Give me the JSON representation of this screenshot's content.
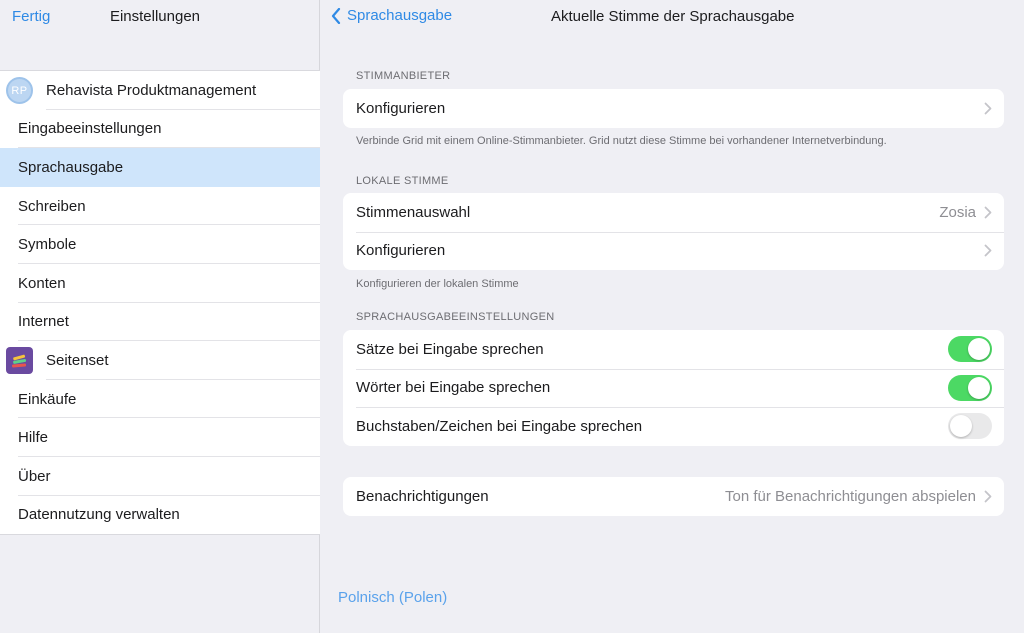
{
  "left": {
    "done_label": "Fertig",
    "title": "Einstellungen",
    "profile": {
      "initials": "RP",
      "name": "Rehavista Produktmanagement"
    },
    "items": [
      {
        "label": "Eingabeeinstellungen"
      },
      {
        "label": "Sprachausgabe"
      },
      {
        "label": "Schreiben"
      },
      {
        "label": "Symbole"
      },
      {
        "label": "Konten"
      },
      {
        "label": "Internet"
      },
      {
        "label": "Seitenset"
      },
      {
        "label": "Einkäufe"
      },
      {
        "label": "Hilfe"
      },
      {
        "label": "Über"
      },
      {
        "label": "Datennutzung verwalten"
      }
    ],
    "selected": "Sprachausgabe"
  },
  "right": {
    "back_label": "Sprachausgabe",
    "title": "Aktuelle Stimme der Sprachausgabe",
    "voice_provider": {
      "section": "STIMMANBIETER",
      "configure_label": "Konfigurieren",
      "footnote": "Verbinde Grid mit einem Online-Stimmanbieter. Grid nutzt diese Stimme bei vorhandener Internetverbindung."
    },
    "local_voice": {
      "section": "LOKALE STIMME",
      "voice_select_label": "Stimmenauswahl",
      "voice_select_value": "Zosia",
      "configure_label": "Konfigurieren",
      "footnote": "Konfigurieren der lokalen Stimme"
    },
    "speech_settings": {
      "section": "SPRACHAUSGABEEINSTELLUNGEN",
      "sentences_label": "Sätze bei Eingabe sprechen",
      "sentences_on": true,
      "words_label": "Wörter bei Eingabe sprechen",
      "words_on": true,
      "letters_label": "Buchstaben/Zeichen bei Eingabe sprechen",
      "letters_on": false
    },
    "notifications": {
      "label": "Benachrichtigungen",
      "value": "Ton für Benachrichtigungen abspielen"
    },
    "language_link": "Polnisch (Polen)"
  },
  "colors": {
    "accent": "#2f8ae5",
    "selected_row": "#cfe5fb",
    "toggle_on": "#4cd964",
    "toggle_off": "#e9e9ea"
  }
}
